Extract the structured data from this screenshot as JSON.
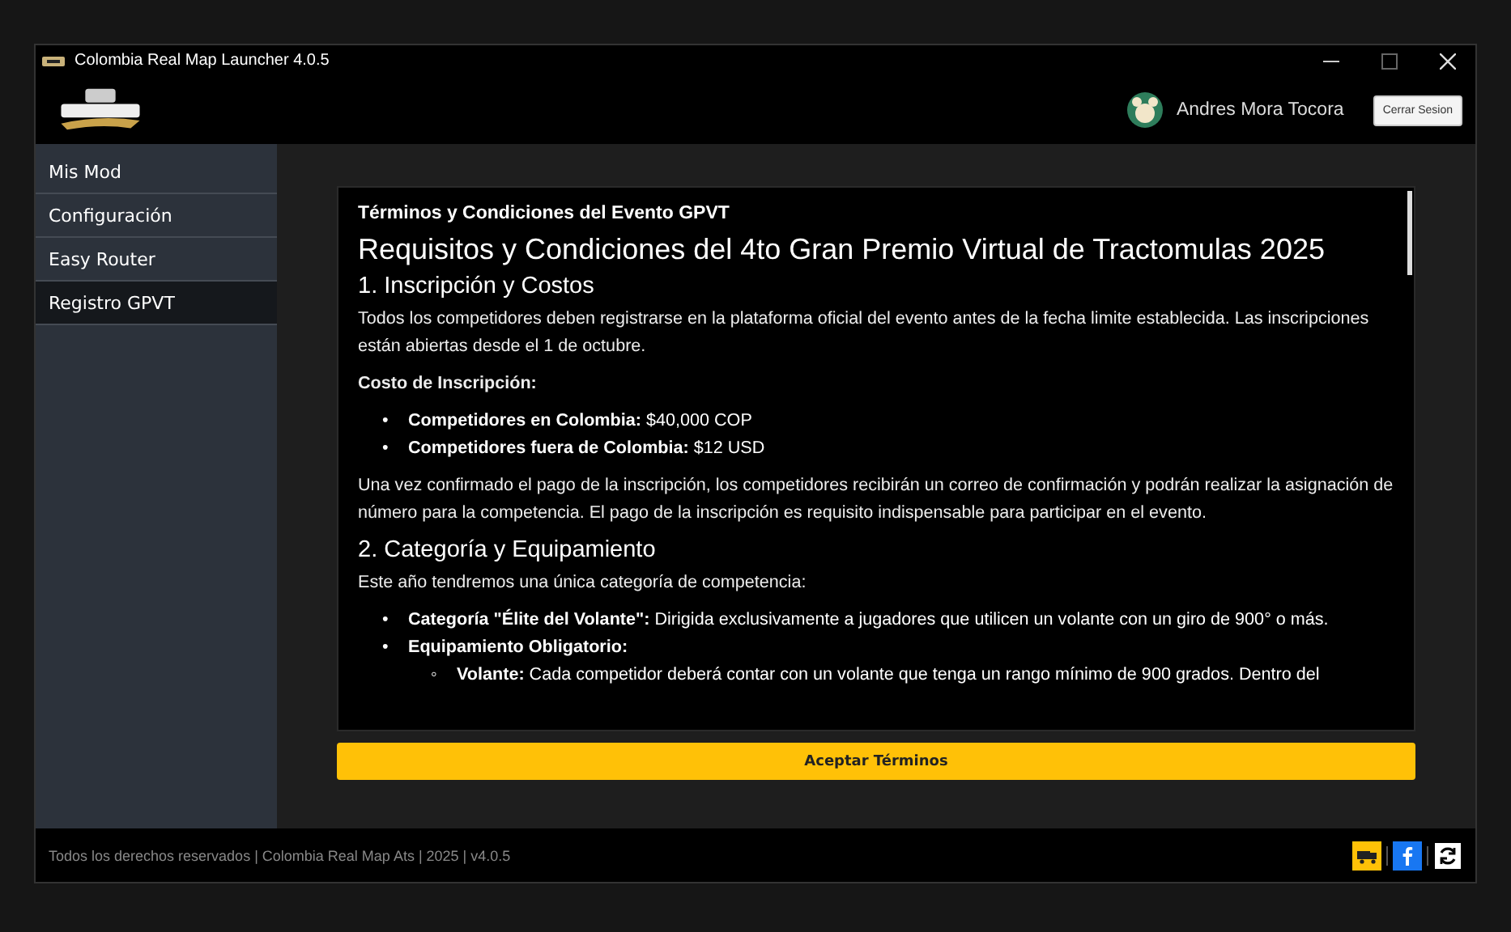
{
  "window": {
    "title": "Colombia Real Map Launcher 4.0.5"
  },
  "header": {
    "user_name": "Andres Mora Tocora",
    "logout_button": "Cerrar Sesion"
  },
  "sidebar": {
    "items": [
      {
        "label": "Mis Mod",
        "selected": false
      },
      {
        "label": "Configuración",
        "selected": false
      },
      {
        "label": "Easy Router",
        "selected": false
      },
      {
        "label": "Registro GPVT",
        "selected": true
      }
    ]
  },
  "terms": {
    "title": "Términos y Condiciones del Evento GPVT",
    "blocks": [
      {
        "kind": "h1",
        "text": "Requisitos y Condiciones del 4to Gran Premio Virtual de Tractomulas 2025"
      },
      {
        "kind": "h2",
        "text": "1. Inscripción y Costos"
      },
      {
        "kind": "p",
        "text": "Todos los competidores deben registrarse en la plataforma oficial del evento antes de la fecha limite establecida. Las inscripciones están abiertas desde el 1 de octubre."
      },
      {
        "kind": "strong",
        "text": "Costo de Inscripción:"
      },
      {
        "kind": "list",
        "items": [
          {
            "marker": "•",
            "text": "**Competidores en Colombia:** $40,000 COP"
          },
          {
            "marker": "•",
            "text": "**Competidores fuera de Colombia:** $12 USD"
          }
        ]
      },
      {
        "kind": "p",
        "text": "Una vez confirmado el pago de la inscripción, los competidores recibirán un correo de confirmación y podrán realizar la asignación de número para la competencia. El pago de la inscripción es requisito indispensable para participar en el evento."
      },
      {
        "kind": "h2",
        "text": "2. Categoría y Equipamiento"
      },
      {
        "kind": "p",
        "text": "Este año tendremos una única categoría de competencia:"
      },
      {
        "kind": "list",
        "items": [
          {
            "marker": "•",
            "text": "**Categoría \"Élite del Volante\":** Dirigida exclusivamente a jugadores que utilicen un volante con un giro de 900° o más."
          },
          {
            "marker": "•",
            "text": "**Equipamiento Obligatorio:**",
            "children": [
              {
                "marker": "◦",
                "text": "**Volante:** Cada competidor deberá contar con un volante que tenga un rango mínimo de 900 grados. Dentro del"
              }
            ]
          }
        ]
      }
    ],
    "accept_button": "Aceptar Términos"
  },
  "footer": {
    "text": "Todos los derechos reservados | Colombia Real Map Ats | 2025 | v4.0.5"
  }
}
